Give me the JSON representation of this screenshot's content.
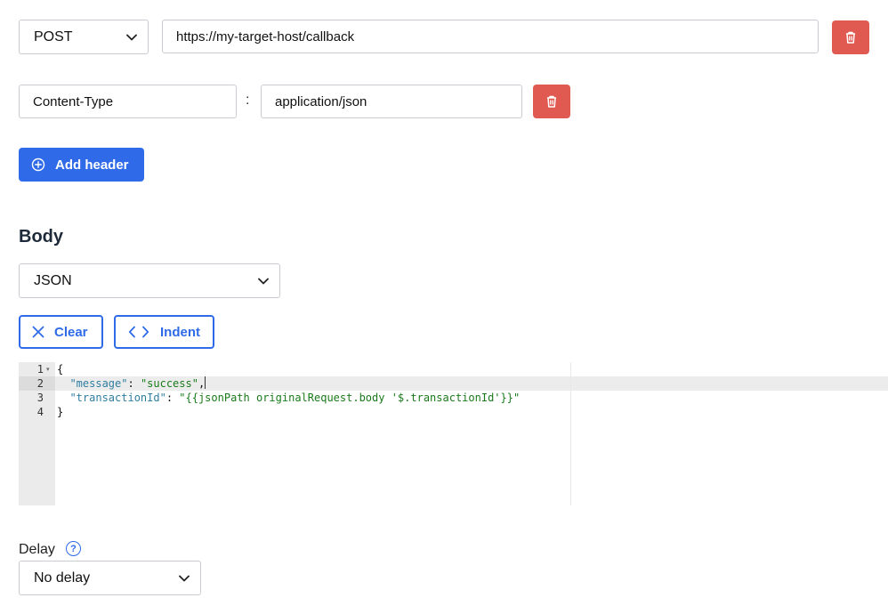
{
  "request": {
    "method": "POST",
    "url": "https://my-target-host/callback"
  },
  "headers": [
    {
      "key": "Content-Type",
      "separator": ":",
      "value": "application/json"
    }
  ],
  "add_header_label": "Add header",
  "body": {
    "title": "Body",
    "format": "JSON",
    "clear_label": "Clear",
    "indent_label": "Indent",
    "editor": {
      "line_numbers": [
        "1",
        "2",
        "3",
        "4"
      ],
      "lines": {
        "l1": "{",
        "l2_key": "\"message\"",
        "l2_colon": ": ",
        "l2_val": "\"success\"",
        "l2_end": ",",
        "l3_key": "\"transactionId\"",
        "l3_colon": ": ",
        "l3_val": "\"{{jsonPath originalRequest.body '$.transactionId'}}\"",
        "l4": "}"
      }
    }
  },
  "delay": {
    "label": "Delay",
    "help_symbol": "?",
    "value": "No delay"
  },
  "colors": {
    "primary": "#2f6be8",
    "danger": "#e05a52"
  }
}
